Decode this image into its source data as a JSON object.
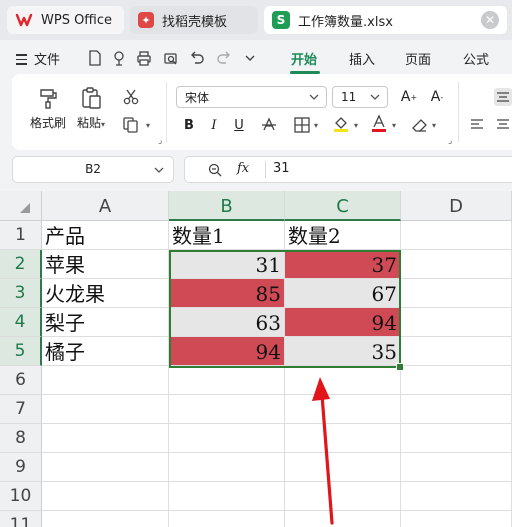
{
  "tabs": [
    {
      "label": "WPS Office",
      "icon": "wps-logo-icon"
    },
    {
      "label": "找稻壳模板",
      "icon": "docer-template-icon"
    },
    {
      "label": "工作簿数量.xlsx",
      "icon": "spreadsheet-s-icon",
      "icon_letter": "S"
    }
  ],
  "menu": {
    "file": "文件",
    "tabs": [
      "开始",
      "插入",
      "页面",
      "公式"
    ],
    "active_tab": "开始"
  },
  "ribbon": {
    "format_painter": "格式刷",
    "paste": "粘贴",
    "font_name": "宋体",
    "font_size": "11",
    "bold": "B",
    "italic": "I",
    "underline": "U"
  },
  "formula_bar": {
    "name_box": "B2",
    "fx": "fx",
    "value": "31"
  },
  "grid": {
    "columns": [
      "A",
      "B",
      "C",
      "D"
    ],
    "selected_columns": [
      "B",
      "C"
    ],
    "rows": [
      "1",
      "2",
      "3",
      "4",
      "5",
      "6",
      "7",
      "8",
      "9",
      "10",
      "11"
    ],
    "selected_rows": [
      "2",
      "3",
      "4",
      "5"
    ],
    "cells": [
      [
        "产品",
        "数量1",
        "数量2"
      ],
      [
        "苹果",
        "31",
        "37"
      ],
      [
        "火龙果",
        "85",
        "67"
      ],
      [
        "梨子",
        "63",
        "94"
      ],
      [
        "橘子",
        "94",
        "35"
      ]
    ],
    "selection_range": "B2:C5"
  },
  "colors": {
    "highlight_fill": "#d04a55",
    "plain_fill": "#e6e6e6",
    "selection_border": "#2e7d32",
    "accent": "#1e8a5a",
    "annotation_arrow": "#e0161b"
  }
}
